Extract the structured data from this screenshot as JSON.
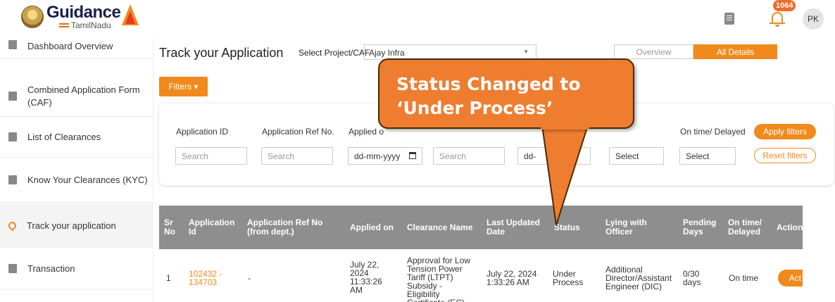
{
  "header": {
    "logo_title": "Guidance",
    "logo_subtitle": "TamilNadu",
    "notification_count": "1064",
    "avatar_initials": "PK"
  },
  "sidebar": {
    "items": [
      {
        "label": "Dashboard Overview",
        "icon": "dashboard-icon"
      },
      {
        "label": "Combined Application Form (CAF)",
        "icon": "document-icon"
      },
      {
        "label": "List of Clearances",
        "icon": "list-icon"
      },
      {
        "label": "Know Your Clearances (KYC)",
        "icon": "book-icon"
      },
      {
        "label": "Track your application",
        "icon": "location-pin-icon",
        "active": true
      },
      {
        "label": "Transaction",
        "icon": "transaction-icon"
      }
    ]
  },
  "main": {
    "title": "Track your Application",
    "select_label": "Select Project/CAF",
    "select_value": "Ajay Infra",
    "tabs": [
      {
        "label": "Overview",
        "active": false
      },
      {
        "label": "All Details",
        "active": true
      }
    ],
    "filters_button": "Filters ▾"
  },
  "filters": {
    "fields": [
      {
        "label": "Application ID",
        "placeholder": "Search"
      },
      {
        "label": "Application Ref No.",
        "placeholder": "Search"
      },
      {
        "label": "Applied o",
        "placeholder": "dd-mm-yyyy"
      },
      {
        "label": "",
        "placeholder": "Search"
      },
      {
        "label": "",
        "placeholder": "dd-"
      },
      {
        "label": "",
        "placeholder": "Select"
      },
      {
        "label": "On time/ Delayed",
        "placeholder": "Select"
      }
    ],
    "apply_label": "Apply filters",
    "reset_label": "Reset filters"
  },
  "table": {
    "headers": [
      "Sr No",
      "Application Id",
      "Application Ref No (from dept.)",
      "Applied on",
      "Clearance Name",
      "Last Updated Date",
      "Status",
      "Lying with Officer",
      "Pending Days",
      "On time/ Delayed",
      "Action"
    ],
    "rows": [
      {
        "sr": "1",
        "app_id": "102432 - 134703",
        "ref_no": "-",
        "applied_on": "July 22, 2024 11:33:26 AM",
        "clearance": "Approval for Low Tension Power Tariff (LTPT) Subsidy - Eligibility Certificate (EC)",
        "last_updated": "July 22, 2024 1:33:26 AM",
        "status": "Under Process",
        "officer": "Additional Director/Assistant Engineer (DIC)",
        "pending": "0/30 days",
        "ontime": "On time",
        "action": "Act"
      }
    ]
  },
  "callout": {
    "line1": "Status Changed to",
    "line2": "‘Under Process’"
  },
  "colors": {
    "accent": "#f08a1c",
    "callout": "#ee7d30",
    "table_header": "#8e8e8e"
  }
}
